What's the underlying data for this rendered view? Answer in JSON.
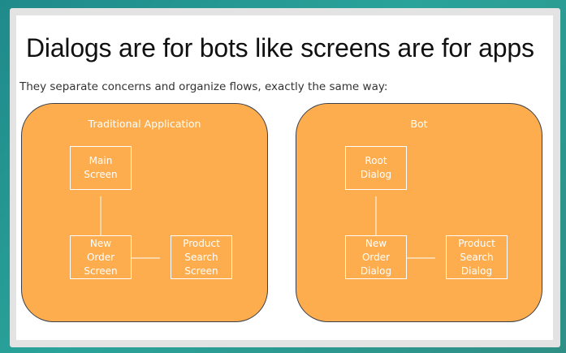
{
  "slide": {
    "title": "Dialogs are for bots like screens are for apps",
    "subtitle": "They separate concerns and organize flows, exactly the same way:"
  },
  "colors": {
    "panel_fill": "#fdad4e",
    "panel_border": "#3b3f4a",
    "node_border": "#ffffff",
    "text_on_panel": "#ffffff",
    "background_teal": "#2aa39a"
  },
  "diagrams": [
    {
      "title": "Traditional Application",
      "nodes": [
        {
          "id": "main",
          "label": [
            "Main",
            "Screen"
          ]
        },
        {
          "id": "new-order",
          "label": [
            "New",
            "Order",
            "Screen"
          ]
        },
        {
          "id": "product-search",
          "label": [
            "Product",
            "Search",
            "Screen"
          ]
        }
      ],
      "edges": [
        {
          "from": "main",
          "to": "new-order"
        },
        {
          "from": "new-order",
          "to": "product-search"
        }
      ]
    },
    {
      "title": "Bot",
      "nodes": [
        {
          "id": "root",
          "label": [
            "Root",
            "Dialog"
          ]
        },
        {
          "id": "new-order",
          "label": [
            "New",
            "Order",
            "Dialog"
          ]
        },
        {
          "id": "product-search",
          "label": [
            "Product",
            "Search",
            "Dialog"
          ]
        }
      ],
      "edges": [
        {
          "from": "root",
          "to": "new-order"
        },
        {
          "from": "new-order",
          "to": "product-search"
        }
      ]
    }
  ]
}
